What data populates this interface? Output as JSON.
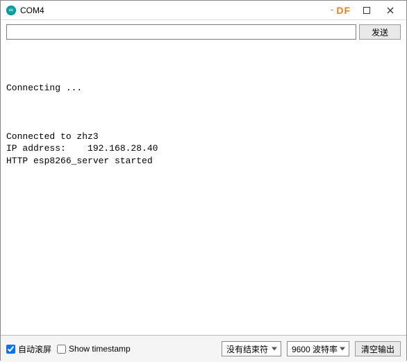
{
  "window": {
    "title": "COM4",
    "brand": "DF"
  },
  "top": {
    "input_value": "",
    "send_label": "发送"
  },
  "console_lines": [
    "",
    "",
    "",
    "Connecting ...",
    "",
    "",
    "",
    "Connected to zhz3",
    "IP address:    192.168.28.40",
    "HTTP esp8266_server started"
  ],
  "bottom": {
    "autoscroll_label": "自动滚屏",
    "autoscroll_checked": true,
    "timestamp_label": "Show timestamp",
    "timestamp_checked": false,
    "line_ending_selected": "没有结束符",
    "baud_selected": "9600 波特率",
    "clear_label": "清空输出"
  }
}
